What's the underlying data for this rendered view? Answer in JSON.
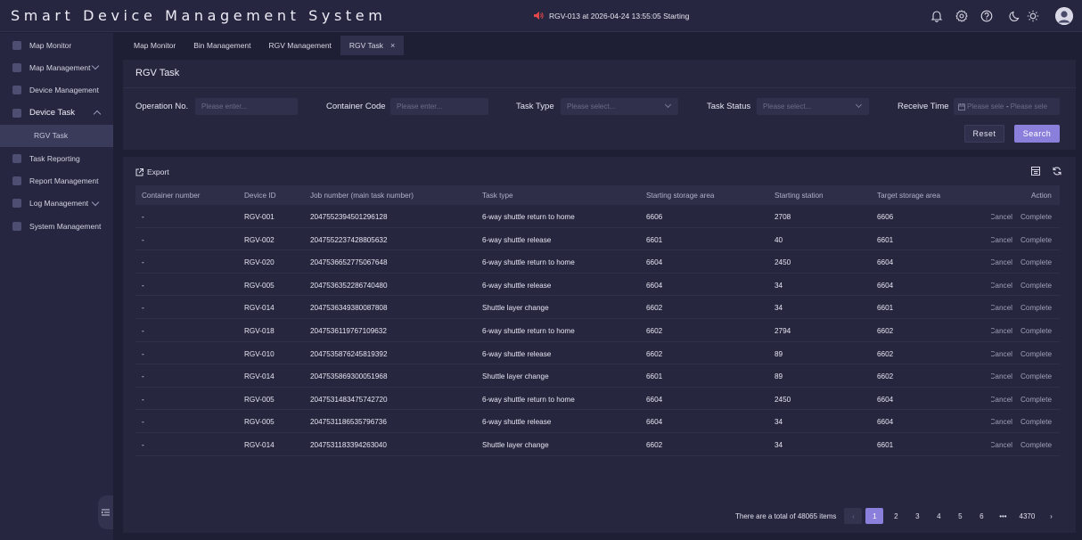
{
  "app": {
    "title": "Smart Device Management System",
    "alarm_text": "RGV-013 at 2026-04-24 13:55:05 Starting"
  },
  "colors": {
    "accent": "#8a80dc",
    "background": "#1e1e34",
    "panel": "#26263f",
    "input": "#30304c"
  },
  "sidebar": {
    "items": [
      {
        "label": "Map Monitor",
        "icon": "monitor-icon"
      },
      {
        "label": "Map Management",
        "icon": "map-icon",
        "expandable": true
      },
      {
        "label": "Device Management",
        "icon": "device-icon"
      },
      {
        "label": "Device Task",
        "icon": "task-icon",
        "expanded": true
      },
      {
        "label": "RGV Task",
        "sub": true,
        "active": true
      },
      {
        "label": "Task Reporting",
        "icon": "report-icon"
      },
      {
        "label": "Report Management",
        "icon": "report-management-icon"
      },
      {
        "label": "Log Management",
        "icon": "log-icon",
        "expandable": true
      },
      {
        "label": "System Management",
        "icon": "settings-icon"
      }
    ]
  },
  "tabs": [
    {
      "label": "Map Monitor"
    },
    {
      "label": "Bin Management"
    },
    {
      "label": "RGV Management"
    },
    {
      "label": "RGV Task",
      "active": true,
      "close": "×"
    }
  ],
  "filter": {
    "title": "RGV Task",
    "operation_no": {
      "label": "Operation No.",
      "placeholder": "Please enter..."
    },
    "container_code": {
      "label": "Container Code",
      "placeholder": "Please enter..."
    },
    "task_type": {
      "label": "Task Type",
      "placeholder": "Please select..."
    },
    "task_status": {
      "label": "Task Status",
      "placeholder": "Please select..."
    },
    "receive_time": {
      "label": "Receive Time",
      "start_placeholder": "Please sele",
      "separator": "-",
      "end_placeholder": "Please sele"
    },
    "reset_label": "Reset",
    "search_label": "Search"
  },
  "toolbar": {
    "export_label": "Export"
  },
  "table": {
    "headers": [
      "Container number",
      "Device ID",
      "Job number (main task number)",
      "Task type",
      "Starting storage area",
      "Starting station",
      "Target storage area",
      "Action"
    ],
    "actions": {
      "cancel": "Cancel",
      "complete": "Complete"
    },
    "rows": [
      [
        "-",
        "RGV-001",
        "2047552394501296128",
        "6-way shuttle return to home",
        "6606",
        "2708",
        "6606"
      ],
      [
        "-",
        "RGV-002",
        "2047552237428805632",
        "6-way shuttle release",
        "6601",
        "40",
        "6601"
      ],
      [
        "-",
        "RGV-020",
        "2047536652775067648",
        "6-way shuttle return to home",
        "6604",
        "2450",
        "6604"
      ],
      [
        "-",
        "RGV-005",
        "2047536352286740480",
        "6-way shuttle release",
        "6604",
        "34",
        "6604"
      ],
      [
        "-",
        "RGV-014",
        "2047536349380087808",
        "Shuttle layer change",
        "6602",
        "34",
        "6601"
      ],
      [
        "-",
        "RGV-018",
        "2047536119767109632",
        "6-way shuttle return to home",
        "6602",
        "2794",
        "6602"
      ],
      [
        "-",
        "RGV-010",
        "2047535876245819392",
        "6-way shuttle release",
        "6602",
        "89",
        "6602"
      ],
      [
        "-",
        "RGV-014",
        "2047535869300051968",
        "Shuttle layer change",
        "6601",
        "89",
        "6602"
      ],
      [
        "-",
        "RGV-005",
        "2047531483475742720",
        "6-way shuttle return to home",
        "6604",
        "2450",
        "6604"
      ],
      [
        "-",
        "RGV-005",
        "2047531186535796736",
        "6-way shuttle release",
        "6604",
        "34",
        "6604"
      ],
      [
        "-",
        "RGV-014",
        "2047531183394263040",
        "Shuttle layer change",
        "6602",
        "34",
        "6601"
      ]
    ]
  },
  "pagination": {
    "total_text": "There are a total of 48065 items",
    "pages": [
      "1",
      "2",
      "3",
      "4",
      "5",
      "6",
      "•••",
      "4370"
    ],
    "current": "1",
    "prev": "‹",
    "next": "›"
  }
}
